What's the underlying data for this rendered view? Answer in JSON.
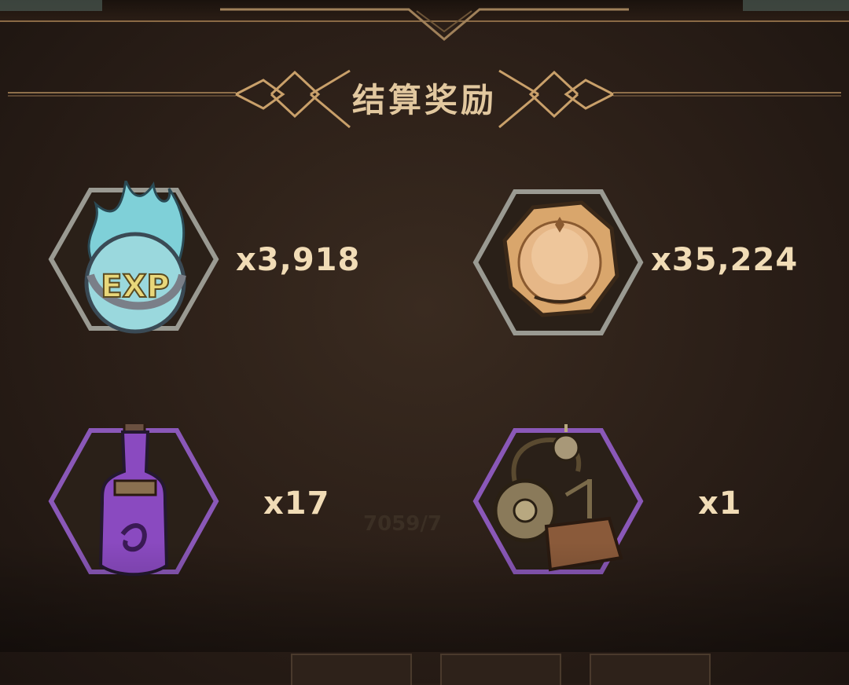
{
  "header": {
    "title": "结算奖励"
  },
  "background_hint": "7059/7",
  "rewards": [
    {
      "name": "exp-orb",
      "amount": "x3,918",
      "frame_color": "#9a9a92"
    },
    {
      "name": "gold-coin",
      "amount": "x35,224",
      "frame_color": "#9a9a92"
    },
    {
      "name": "purple-potion",
      "amount": "x17",
      "frame_color": "#8a58b8"
    },
    {
      "name": "clockwork-device",
      "amount": "x1",
      "frame_color": "#8a58b8"
    }
  ],
  "colors": {
    "accent": "#c9a06a",
    "title": "#e2c89f",
    "amount": "#f1dcb6"
  }
}
